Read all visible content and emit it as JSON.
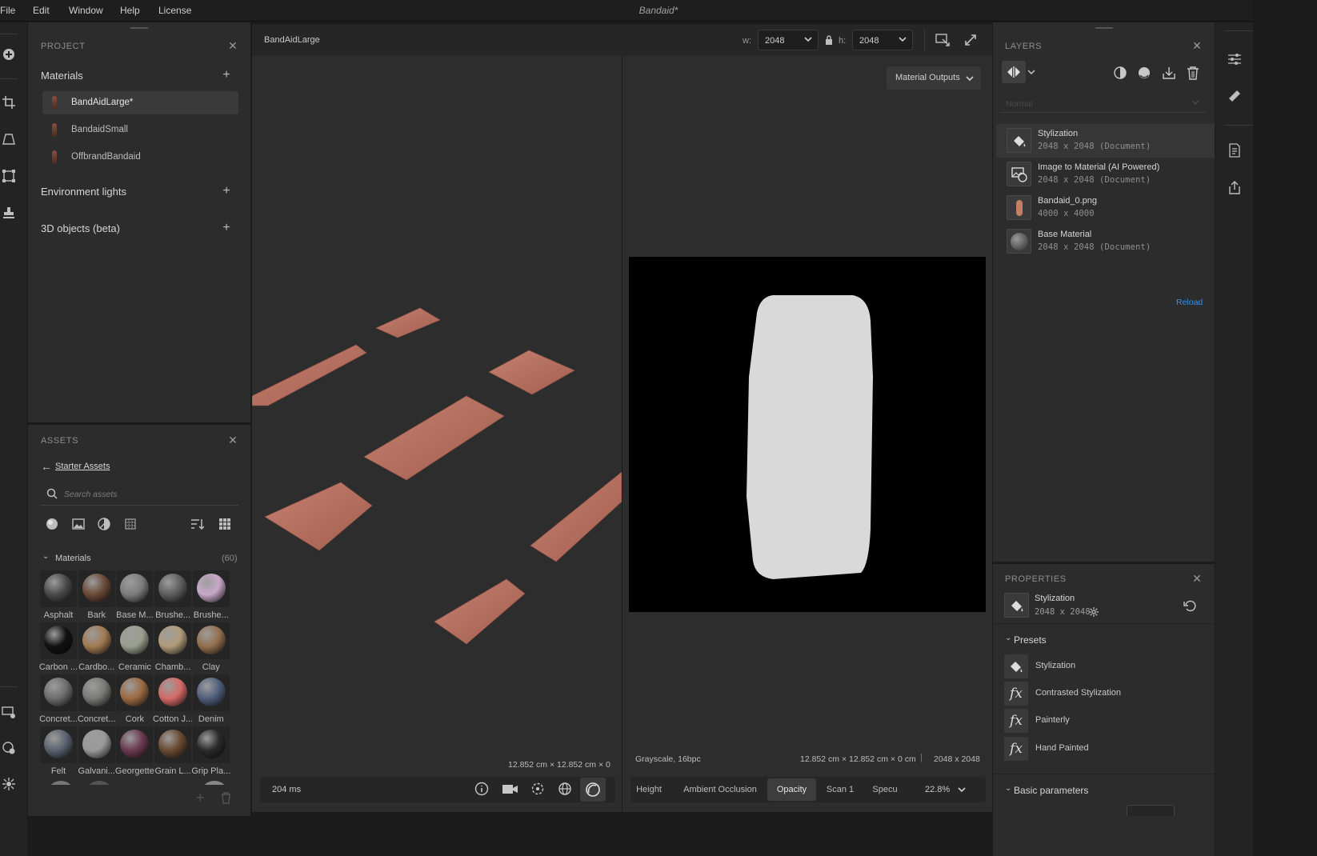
{
  "menu": [
    "File",
    "Edit",
    "Window",
    "Help",
    "License"
  ],
  "document_title": "Bandaid*",
  "project": {
    "title": "PROJECT",
    "materials_header": "Materials",
    "materials": [
      "BandAidLarge*",
      "BandaidSmall",
      "OffbrandBandaid"
    ],
    "environment_lights": "Environment lights",
    "objects_3d": "3D objects (beta)"
  },
  "assets": {
    "title": "ASSETS",
    "back_link": "Starter Assets",
    "search_placeholder": "Search assets",
    "materials_label": "Materials",
    "materials_count": "(60)",
    "items": [
      {
        "label": "Asphalt",
        "color": "#4a4a4a"
      },
      {
        "label": "Bark",
        "color": "#6b4a38"
      },
      {
        "label": "Base M...",
        "color": "#7d7d7d"
      },
      {
        "label": "Brushe...",
        "color": "#5e5e5e"
      },
      {
        "label": "Brushe...",
        "color": "#c9a8c9"
      },
      {
        "label": "Carbon ...",
        "color": "#111111"
      },
      {
        "label": "Cardbo...",
        "color": "#a07a52"
      },
      {
        "label": "Ceramic",
        "color": "#9aa08e"
      },
      {
        "label": "Chamb...",
        "color": "#b09a7a"
      },
      {
        "label": "Clay",
        "color": "#94704e"
      },
      {
        "label": "Concret...",
        "color": "#6e6e6e"
      },
      {
        "label": "Concret...",
        "color": "#7a7a76"
      },
      {
        "label": "Cork",
        "color": "#9c6a42"
      },
      {
        "label": "Cotton J...",
        "color": "#d46a66"
      },
      {
        "label": "Denim",
        "color": "#4f5f7c"
      },
      {
        "label": "Felt",
        "color": "#5a6270"
      },
      {
        "label": "Galvani...",
        "color": "#9a9a9a"
      },
      {
        "label": "Georgette",
        "color": "#6a3a50"
      },
      {
        "label": "Grain L...",
        "color": "#6a4a32"
      },
      {
        "label": "Grip Pla...",
        "color": "#2a2a2a"
      }
    ]
  },
  "viewport": {
    "tab_name": "BandAidLarge",
    "w_label": "w:",
    "w_value": "2048",
    "h_label": "h:",
    "h_value": "2048",
    "material_outputs": "Material Outputs",
    "dims_3d": "12.852 cm × 12.852 cm × 0 cm",
    "render_time": "204 ms",
    "info_2d": "Grayscale, 16bpc",
    "dims_2d": "12.852 cm × 12.852 cm × 0 cm",
    "resolution_2d": "2048 x 2048",
    "channels": [
      "Height",
      "Ambient Occlusion",
      "Opacity",
      "Scan 1",
      "Specu"
    ],
    "active_channel": "Opacity",
    "zoom": "22.8%"
  },
  "layers": {
    "title": "LAYERS",
    "blend_mode": "Normal",
    "items": [
      {
        "name": "Stylization",
        "sub": "2048 x 2048 (Document)"
      },
      {
        "name": "Image to Material (AI Powered)",
        "sub": "2048 x 2048 (Document)"
      },
      {
        "name": "Bandaid_0.png",
        "sub": "4000 x 4000"
      },
      {
        "name": "Base Material",
        "sub": "2048 x 2048 (Document)"
      }
    ],
    "reload": "Reload"
  },
  "properties": {
    "title": "PROPERTIES",
    "name": "Stylization",
    "size": "2048 x 2048",
    "presets_label": "Presets",
    "presets": [
      "Stylization",
      "Contrasted Stylization",
      "Painterly",
      "Hand Painted"
    ],
    "basic_parameters": "Basic parameters"
  },
  "colors": {
    "accent_link": "#3a8fe0",
    "bandaid": "#b86e5c"
  }
}
